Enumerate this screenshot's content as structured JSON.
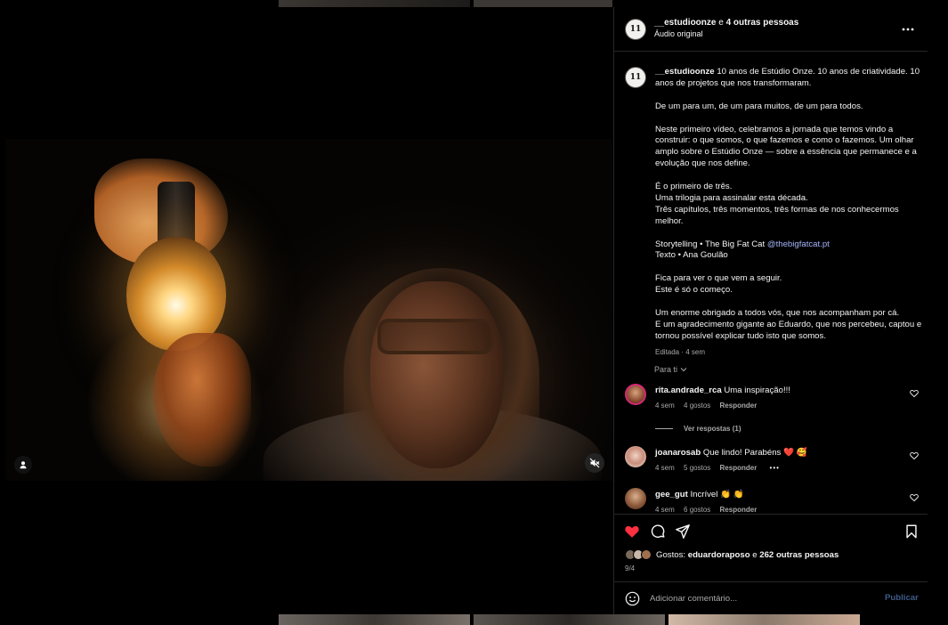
{
  "header": {
    "avatar_initials": "11",
    "author": "__estudioonze",
    "collab_joiner": "e",
    "collab_others": "4 outras pessoas",
    "audio": "Áudio original",
    "more_icon": "more-horizontal-icon"
  },
  "caption": {
    "username": "__estudioonze",
    "paragraphs": [
      "10 anos de Estúdio Onze. 10 anos de criatividade. 10 anos de projetos que nos transformaram.",
      "De um para um, de um para muitos, de um para todos.",
      "Neste primeiro vídeo, celebramos a jornada que temos vindo a construir: o que somos, o que fazemos e como o fazemos. Um olhar amplo sobre o Estúdio Onze — sobre a essência que permanece e a evolução que nos define.",
      "É o primeiro de três.\nUma trilogia para assinalar esta década.\nTrês capítulos, três momentos, três formas de nos conhecermos melhor.",
      "Fica para ver o que vem a seguir.\nEste é só o começo.",
      "Um enorme obrigado a todos vós, que nos acompanham por cá.\nE um agradecimento gigante ao Eduardo, que nos percebeu, captou e tornou possível explicar tudo isto que somos."
    ],
    "credits_storytelling": "Storytelling • The Big Fat Cat",
    "credits_mention": "@thebigfatcat.pt",
    "credits_text": "Texto • Ana Goulão",
    "edited": "Editada · 4 sem"
  },
  "for_you": "Para ti",
  "comments": [
    {
      "username": "rita.andrade_rca",
      "text": "Uma inspiração!!!",
      "time": "4 sem",
      "likes": "4 gostos",
      "reply": "Responder",
      "avatar_color": "#b07a5a"
    },
    {
      "username": "joanarosab",
      "text": "Que lindo! Parabéns ❤️ 🥰",
      "time": "4 sem",
      "likes": "5 gostos",
      "reply": "Responder",
      "more": "•••",
      "avatar_color": "#e8d9d0"
    },
    {
      "username": "gee_gut",
      "text": "Incrível 👏 👏",
      "time": "4 sem",
      "likes": "6 gostos",
      "reply": "Responder",
      "avatar_color": "#9b6e4f"
    }
  ],
  "view_replies": "Ver respostas (1)",
  "likes": {
    "prefix": "Gostos:",
    "user": "eduardoraposo",
    "joiner": "e",
    "others": "262 outras pessoas"
  },
  "date": "9/4",
  "add_comment": {
    "placeholder": "Adicionar comentário...",
    "publish": "Publicar"
  },
  "colors": {
    "like_red": "#ff3040",
    "mention_blue": "#a5b5f9",
    "publish_disabled": "#3f5b8a"
  }
}
